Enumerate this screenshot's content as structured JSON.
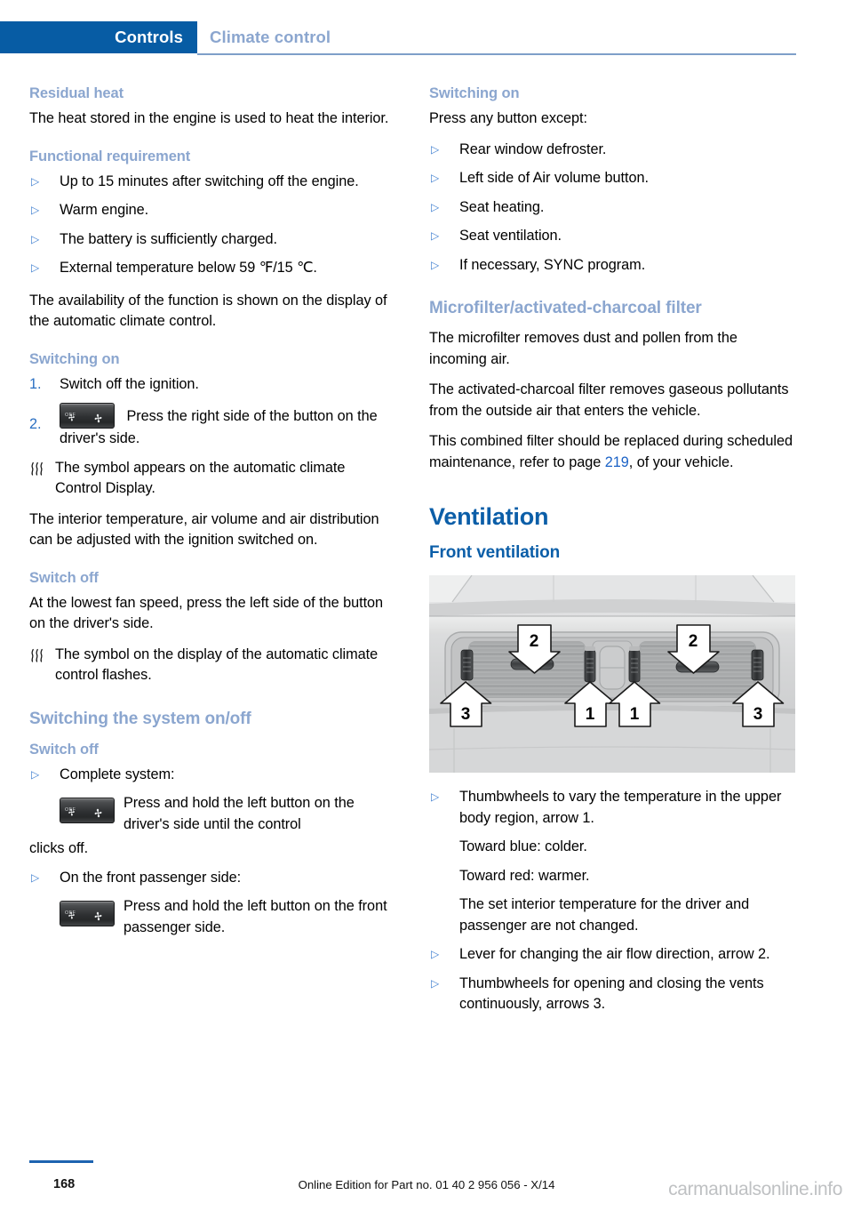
{
  "header": {
    "active_tab": "Controls",
    "inactive_tab": "Climate control",
    "active_tab_color": "#075ca4",
    "inactive_tab_color": "#8ba6cf"
  },
  "colors": {
    "heading_strong_blue": "#0b5ea8",
    "heading_pale_blue": "#8ba6cf",
    "bullet_blue": "#3f7fd0",
    "link_blue": "#1b62c6"
  },
  "left_column": {
    "residual_heat": {
      "title": "Residual heat",
      "intro": "The heat stored in the engine is used to heat the interior."
    },
    "functional_requirement": {
      "title": "Functional requirement",
      "items": [
        "Up to 15 minutes after switching off the engine.",
        "Warm engine.",
        "The battery is sufficiently charged.",
        "External temperature below 59 ℉/15 ℃."
      ],
      "after_text": "The availability of the function is shown on the display of the automatic climate control."
    },
    "switching_on": {
      "title": "Switching on",
      "step1_number": "1.",
      "step1_text": "Switch off the ignition.",
      "step2_number": "2.",
      "step2_text": "Press the right side of the button on the driver's side.",
      "note": "The symbol appears on the automatic climate Control Display.",
      "after_text": "The interior temperature, air volume and air distribution can be adjusted with the ignition switched on."
    },
    "switch_off": {
      "title": "Switch off",
      "text": "At the lowest fan speed, press the left side of the button on the driver's side.",
      "note": "The symbol on the display of the automatic climate control flashes."
    },
    "switching_system": {
      "title": "Switching the system on/off",
      "subtitle": "Switch off",
      "item1": "Complete system:",
      "item1_btn_text": "Press and hold the left button on the driver's side until the control",
      "item1_trailing": "clicks off.",
      "item2": "On the front passenger side:",
      "item2_btn_text": "Press and hold the left button on the front passenger side."
    }
  },
  "right_column": {
    "switching_on": {
      "title": "Switching on",
      "intro": "Press any button except:",
      "items": [
        "Rear window defroster.",
        "Left side of Air volume button.",
        "Seat heating.",
        "Seat ventilation.",
        "If necessary, SYNC program."
      ]
    },
    "microfilter": {
      "title": "Microfilter/activated-charcoal filter",
      "p1": "The microfilter removes dust and pollen from the incoming air.",
      "p2": "The activated-charcoal filter removes gaseous pollutants from the outside air that enters the vehicle.",
      "p3_before": "This combined filter should be replaced during scheduled maintenance, refer to page ",
      "p3_link": "219",
      "p3_after": ", of your vehicle."
    },
    "ventilation": {
      "title": "Ventilation",
      "front_title": "Front ventilation",
      "figure_caption_labels": [
        "2",
        "2",
        "1",
        "1",
        "3",
        "3"
      ],
      "items": [
        {
          "main": "Thumbwheels to vary the temperature in the upper body region, arrow 1.",
          "subs": [
            "Toward blue: colder.",
            "Toward red: warmer.",
            "The set interior temperature for the driver and passenger are not changed."
          ]
        },
        {
          "main": "Lever for changing the air flow direction, arrow 2.",
          "subs": []
        },
        {
          "main": "Thumbwheels for opening and closing the vents continuously, arrows 3.",
          "subs": []
        }
      ]
    }
  },
  "footer": {
    "page_number": "168",
    "edition_text": "Online Edition for Part no. 01 40 2 956 056 - X/14",
    "watermark": "carmanualsonline.info"
  },
  "button_icon": {
    "off_label": "OFF"
  }
}
